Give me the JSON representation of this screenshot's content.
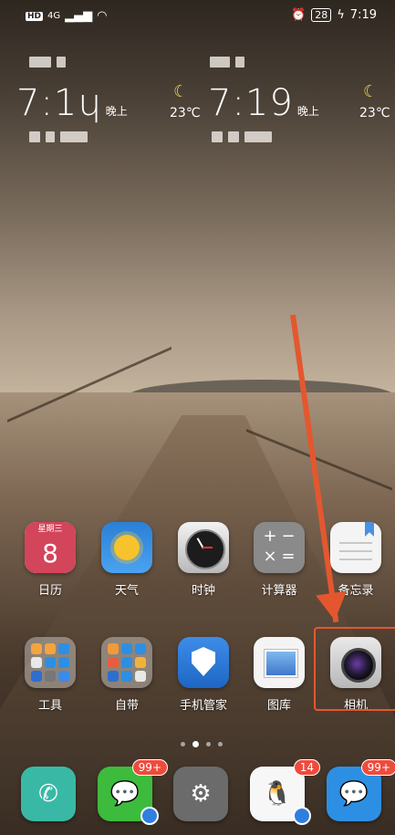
{
  "status_bar": {
    "hd": "HD",
    "network": "4G",
    "battery": "28",
    "time": "7:19"
  },
  "clock_widgets": [
    {
      "time": "7:1ɥ",
      "ampm": "晚上",
      "temp": "23℃"
    },
    {
      "time": "7:19",
      "ampm": "晚上",
      "temp": "23℃"
    }
  ],
  "row1": [
    {
      "label": "日历",
      "icon": "calendar-icon",
      "header": "星期三",
      "day": "8"
    },
    {
      "label": "天气",
      "icon": "weather-icon"
    },
    {
      "label": "时钟",
      "icon": "clock-icon"
    },
    {
      "label": "计算器",
      "icon": "calculator-icon"
    },
    {
      "label": "备忘录",
      "icon": "notes-icon"
    }
  ],
  "row2": [
    {
      "label": "工具",
      "icon": "folder-icon"
    },
    {
      "label": "自带",
      "icon": "folder-icon"
    },
    {
      "label": "手机管家",
      "icon": "shield-icon"
    },
    {
      "label": "图库",
      "icon": "gallery-icon"
    },
    {
      "label": "相机",
      "icon": "camera-icon"
    }
  ],
  "calculator_glyphs": [
    "+",
    "−",
    "×",
    "="
  ],
  "page_indicator": {
    "pages": 4,
    "current": 2
  },
  "dock": [
    {
      "app": "phone",
      "icon": "phone-icon",
      "glyph": "✆",
      "badge": ""
    },
    {
      "app": "wechat",
      "icon": "wechat-icon",
      "glyph": "💬",
      "badge": "99+"
    },
    {
      "app": "settings",
      "icon": "settings-icon",
      "glyph": "⚙",
      "badge": ""
    },
    {
      "app": "qq",
      "icon": "qq-icon",
      "glyph": "🐧",
      "badge": "14"
    },
    {
      "app": "messages",
      "icon": "messages-icon",
      "glyph": "💬",
      "badge": "99+"
    }
  ],
  "colors": {
    "accent": "#e4572e",
    "badge": "#ef4b3c"
  }
}
